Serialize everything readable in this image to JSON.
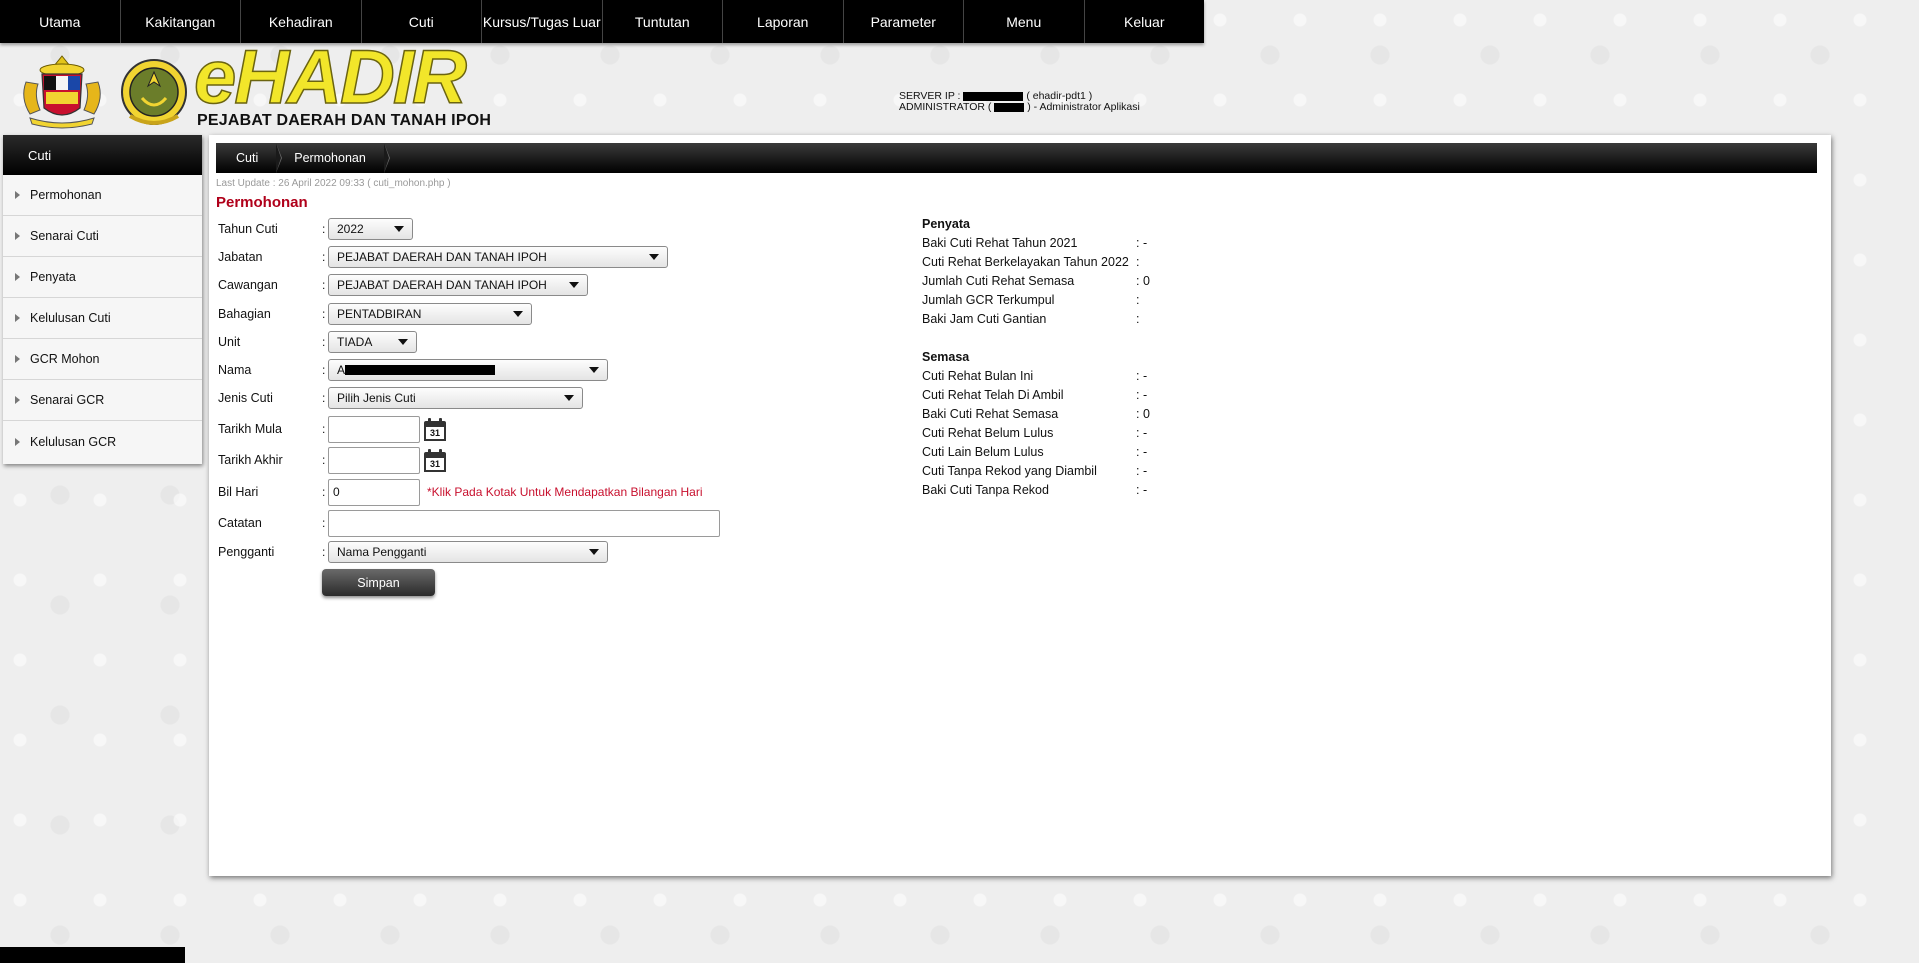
{
  "nav": [
    "Utama",
    "Kakitangan",
    "Kehadiran",
    "Cuti",
    "Kursus/Tugas Luar",
    "Tuntutan",
    "Laporan",
    "Parameter",
    "Menu",
    "Keluar"
  ],
  "header": {
    "logo_text": "eHADIR",
    "office_name": "PEJABAT DAERAH DAN TANAH IPOH",
    "server_label": "SERVER IP :",
    "server_host": "( ehadir-pdt1 )",
    "admin_label": "ADMINISTRATOR (",
    "admin_role": ") - Administrator Aplikasi"
  },
  "sidebar": {
    "title": "Cuti",
    "items": [
      "Permohonan",
      "Senarai Cuti",
      "Penyata",
      "Kelulusan Cuti",
      "GCR Mohon",
      "Senarai GCR",
      "Kelulusan GCR"
    ]
  },
  "breadcrumb": [
    "Cuti",
    "Permohonan"
  ],
  "last_update": "Last Update : 26 April 2022 09:33 ( cuti_mohon.php )",
  "page_title": "Permohonan",
  "form": {
    "tahun_cuti": {
      "label": "Tahun Cuti",
      "value": "2022"
    },
    "jabatan": {
      "label": "Jabatan",
      "value": "PEJABAT DAERAH DAN TANAH IPOH"
    },
    "cawangan": {
      "label": "Cawangan",
      "value": "PEJABAT DAERAH DAN TANAH IPOH"
    },
    "bahagian": {
      "label": "Bahagian",
      "value": "PENTADBIRAN"
    },
    "unit": {
      "label": "Unit",
      "value": "TIADA"
    },
    "nama": {
      "label": "Nama",
      "value": "A"
    },
    "jenis_cuti": {
      "label": "Jenis Cuti",
      "value": "Pilih Jenis Cuti"
    },
    "tarikh_mula": {
      "label": "Tarikh Mula",
      "value": ""
    },
    "tarikh_akhir": {
      "label": "Tarikh Akhir",
      "value": ""
    },
    "bil_hari": {
      "label": "Bil Hari",
      "value": "0",
      "hint": "*Klik Pada Kotak Untuk Mendapatkan Bilangan Hari"
    },
    "catatan": {
      "label": "Catatan",
      "value": ""
    },
    "pengganti": {
      "label": "Pengganti",
      "value": "Nama Pengganti"
    },
    "colon": ":",
    "calendar_day": "31",
    "submit_label": "Simpan"
  },
  "penyata": {
    "title": "Penyata",
    "rows": [
      {
        "label": "Baki Cuti Rehat Tahun 2021",
        "value": ": -"
      },
      {
        "label": "Cuti Rehat Berkelayakan Tahun 2022",
        "value": ":"
      },
      {
        "label": "Jumlah Cuti Rehat Semasa",
        "value": ": 0"
      },
      {
        "label": "Jumlah GCR Terkumpul",
        "value": ":"
      },
      {
        "label": "Baki Jam Cuti Gantian",
        "value": ":"
      }
    ]
  },
  "semasa": {
    "title": "Semasa",
    "rows": [
      {
        "label": "Cuti Rehat Bulan Ini",
        "value": ": -"
      },
      {
        "label": "Cuti Rehat Telah Di Ambil",
        "value": ": -"
      },
      {
        "label": "Baki Cuti Rehat Semasa",
        "value": ": 0"
      },
      {
        "label": "Cuti Rehat Belum Lulus",
        "value": ": -"
      },
      {
        "label": "Cuti Lain Belum Lulus",
        "value": ": -"
      },
      {
        "label": "Cuti Tanpa Rekod yang Diambil",
        "value": ": -"
      },
      {
        "label": "Baki Cuti Tanpa Rekod",
        "value": ": -"
      }
    ]
  },
  "icons": {
    "crest": "malaysia-coat-of-arms",
    "emblem": "perak-state-emblem",
    "calendar": "calendar-icon",
    "caret": "chevron-down-icon",
    "sidebar_arrow": "caret-right-icon"
  },
  "colors": {
    "accent_red": "#b0001a",
    "hint_red": "#c8102e",
    "logo_yellow": "#f2e62a",
    "nav_black": "#000000"
  }
}
